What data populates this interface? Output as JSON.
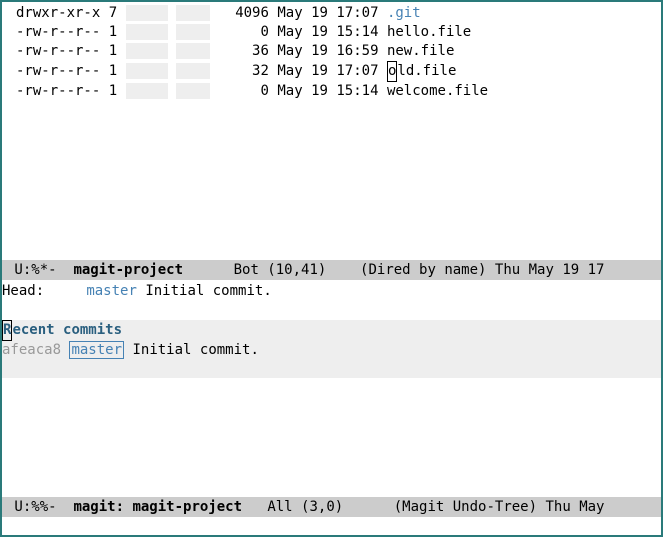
{
  "dired": {
    "lines": [
      {
        "perms": "drwxr-xr-x 7",
        "dim1": "     ",
        "dim2": "    ",
        "size": "  4096",
        "date": "May 19 17:07",
        "name": ".git",
        "is_dir": true,
        "cursor_at": null
      },
      {
        "perms": "-rw-r--r-- 1",
        "dim1": "     ",
        "dim2": "    ",
        "size": "     0",
        "date": "May 19 15:14",
        "name": "hello.file",
        "is_dir": false,
        "cursor_at": null
      },
      {
        "perms": "-rw-r--r-- 1",
        "dim1": "     ",
        "dim2": "    ",
        "size": "    36",
        "date": "May 19 16:59",
        "name": "new.file",
        "is_dir": false,
        "cursor_at": null
      },
      {
        "perms": "-rw-r--r-- 1",
        "dim1": "     ",
        "dim2": "    ",
        "size": "    32",
        "date": "May 19 17:07",
        "name": "old.file",
        "is_dir": false,
        "cursor_at": 0
      },
      {
        "perms": "-rw-r--r-- 1",
        "dim1": "     ",
        "dim2": "    ",
        "size": "     0",
        "date": "May 19 15:14",
        "name": "welcome.file",
        "is_dir": false,
        "cursor_at": null
      }
    ]
  },
  "top_modeline": {
    "flags": " U:%*-",
    "buffer": "magit-project",
    "pos": "Bot (10,41)",
    "mode": "(Dired by name)",
    "time": "Thu May 19 17"
  },
  "magit": {
    "head_label": "Head:",
    "head_branch": "master",
    "head_msg": "Initial commit.",
    "section_title": "Recent commits",
    "commit": {
      "hash": "afeaca8",
      "branch": "master",
      "msg": "Initial commit."
    }
  },
  "bottom_modeline": {
    "flags": " U:%%-",
    "buffer": "magit: magit-project",
    "pos": "All (3,0)",
    "mode": "(Magit Undo-Tree)",
    "time": "Thu May "
  }
}
